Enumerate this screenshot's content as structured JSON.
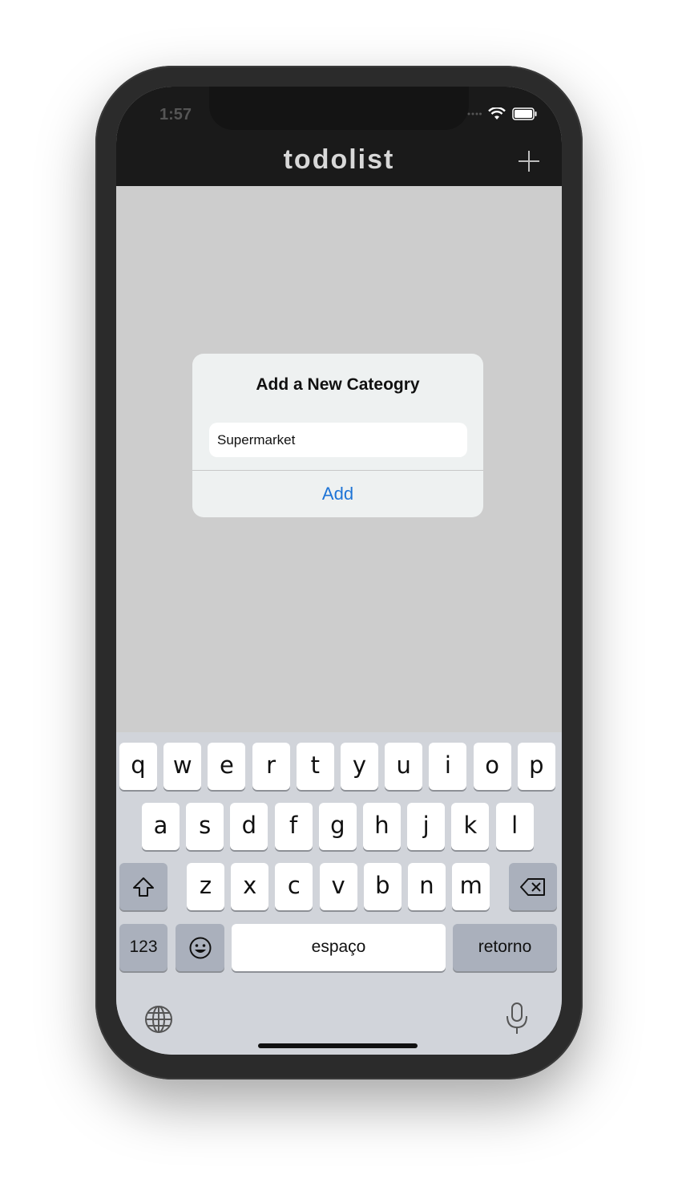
{
  "status_bar": {
    "time": "1:57",
    "icons": [
      "signal-dots-icon",
      "wifi-icon",
      "battery-icon"
    ]
  },
  "nav": {
    "title": "todolist",
    "add_icon": "plus-icon"
  },
  "alert": {
    "title": "Add a New Cateogry",
    "input_value": "Supermarket",
    "action_label": "Add",
    "action_color": "#1e74d6"
  },
  "keyboard": {
    "row1": [
      "q",
      "w",
      "e",
      "r",
      "t",
      "y",
      "u",
      "i",
      "o",
      "p"
    ],
    "row2": [
      "a",
      "s",
      "d",
      "f",
      "g",
      "h",
      "j",
      "k",
      "l"
    ],
    "row3": [
      "z",
      "x",
      "c",
      "v",
      "b",
      "n",
      "m"
    ],
    "shift_icon": "shift-icon",
    "delete_icon": "delete-icon",
    "numbers_label": "123",
    "emoji_icon": "emoji-icon",
    "space_label": "espaço",
    "return_label": "retorno",
    "globe_icon": "globe-icon",
    "mic_icon": "microphone-icon"
  }
}
